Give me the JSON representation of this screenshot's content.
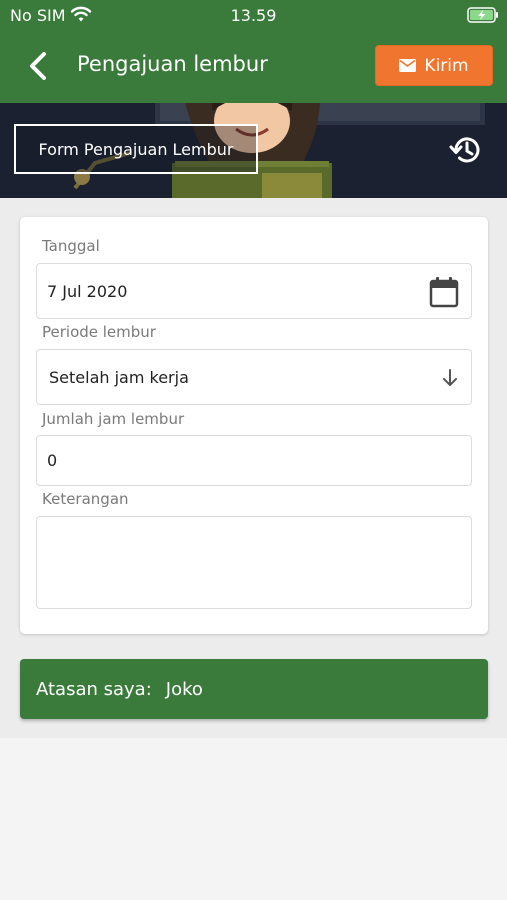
{
  "status_bar": {
    "carrier": "No SIM",
    "time": "13.59"
  },
  "header": {
    "title": "Pengajuan lembur",
    "send_label": "Kirim"
  },
  "banner": {
    "label": "Form Pengajuan Lembur"
  },
  "form": {
    "date_label": "Tanggal",
    "date_value": "7 Jul 2020",
    "period_label": "Periode lembur",
    "period_value": "Setelah jam kerja",
    "hours_label": "Jumlah jam lembur",
    "hours_value": "0",
    "note_label": "Keterangan",
    "note_value": ""
  },
  "supervisor": {
    "label": "Atasan saya:",
    "name": "Joko"
  },
  "colors": {
    "primary_green": "#3a7b3c",
    "accent_orange": "#f0762f",
    "banner_dark": "#1b2130"
  }
}
